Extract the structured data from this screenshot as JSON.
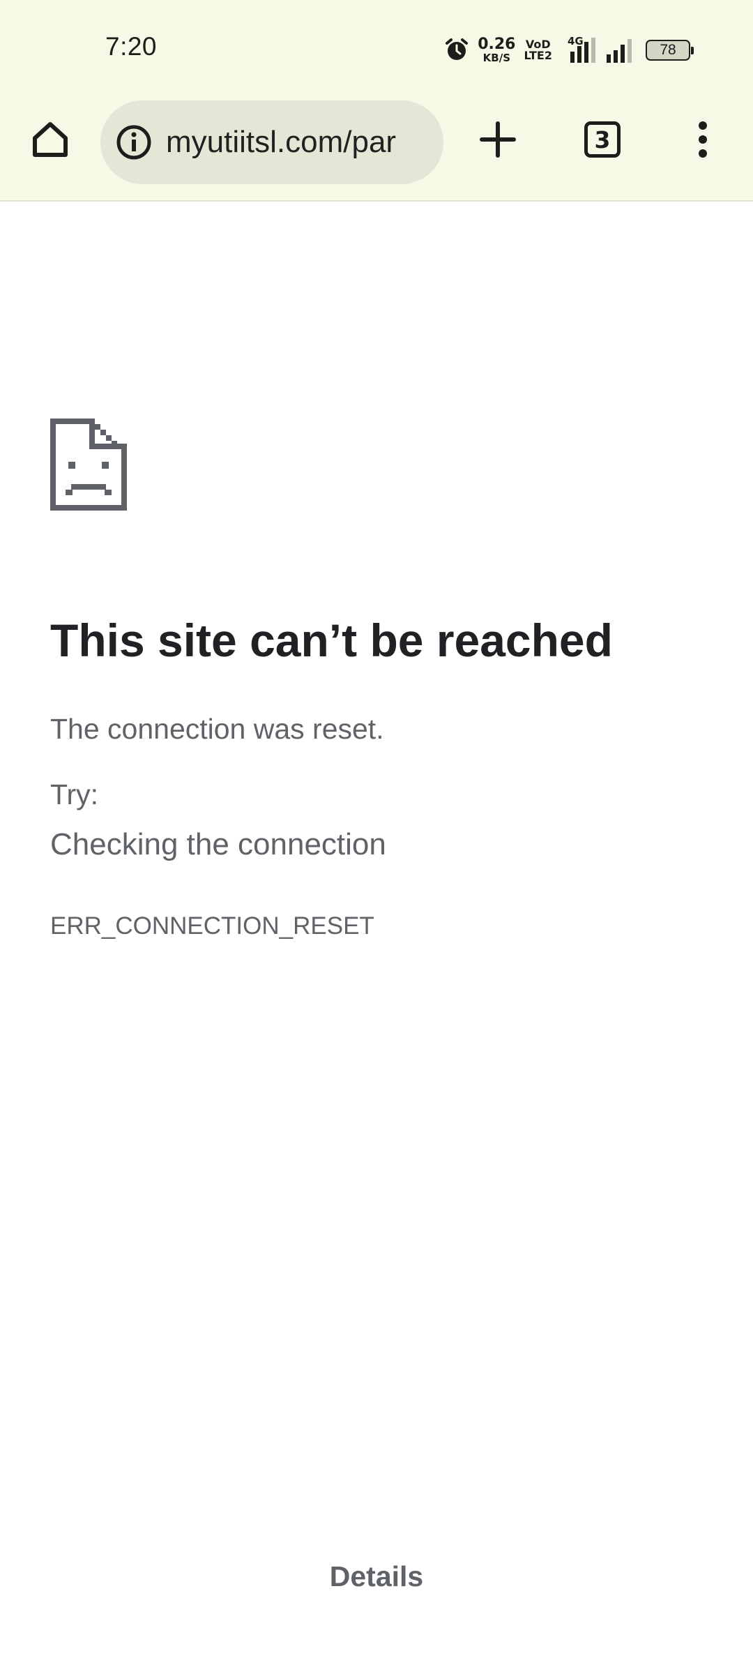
{
  "status_bar": {
    "time": "7:20",
    "net_speed_value": "0.26",
    "net_speed_unit": "KB/S",
    "volte_top": "VoD",
    "volte_bottom": "LTE2",
    "network_type": "4G",
    "battery_level": "78",
    "icons": [
      "alarm-icon",
      "signal-icon",
      "signal-icon",
      "battery-icon"
    ]
  },
  "toolbar": {
    "url": "myutiitsl.com/par",
    "tab_count": "3",
    "icons": [
      "home-icon",
      "info-icon",
      "plus-icon",
      "tab-switcher-icon",
      "more-vert-icon"
    ]
  },
  "error_page": {
    "icon": "sad-page-icon",
    "title": "This site can’t be reached",
    "message": "The connection was reset.",
    "try_label": "Try:",
    "suggestions": [
      "Checking the connection"
    ],
    "error_code": "ERR_CONNECTION_RESET",
    "details_label": "Details"
  },
  "colors": {
    "chrome_bg": "#f8f8e6",
    "url_bar_bg": "#e5e6d6",
    "title_text": "#202124",
    "secondary_text": "#5f6368"
  }
}
